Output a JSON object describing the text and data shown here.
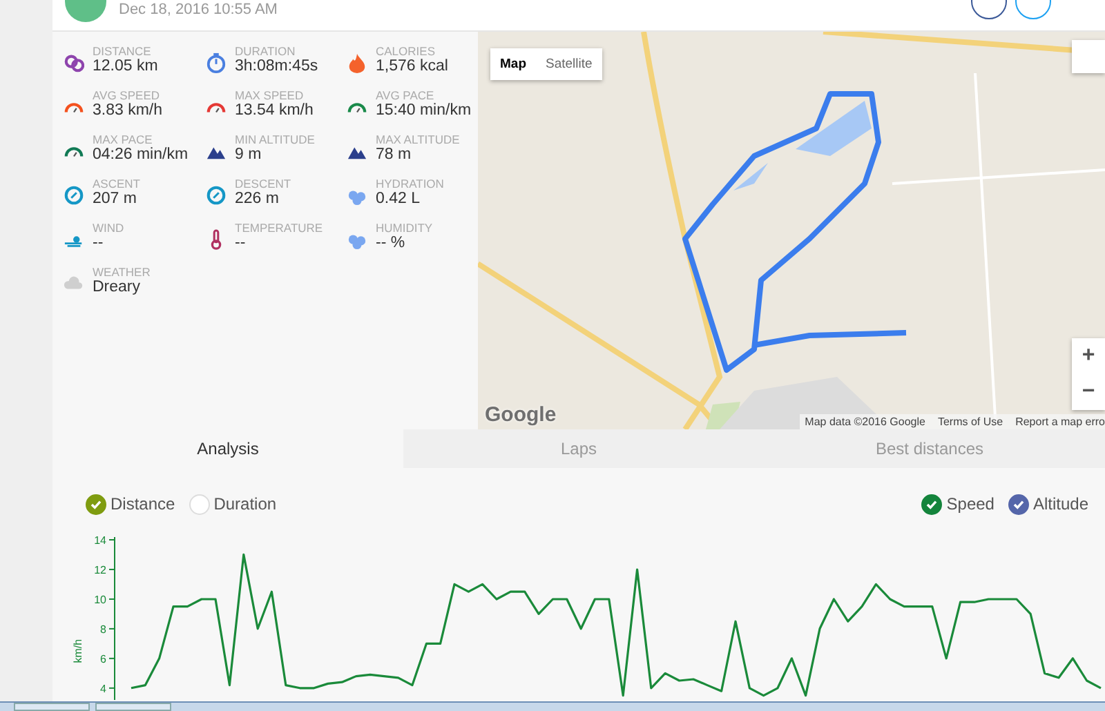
{
  "header": {
    "date": "Dec 18, 2016 10:55 AM"
  },
  "stats": [
    {
      "label": "DISTANCE",
      "value": "12.05 km"
    },
    {
      "label": "DURATION",
      "value": "3h:08m:45s"
    },
    {
      "label": "CALORIES",
      "value": "1,576 kcal"
    },
    {
      "label": "AVG SPEED",
      "value": "3.83 km/h"
    },
    {
      "label": "MAX SPEED",
      "value": "13.54 km/h"
    },
    {
      "label": "AVG PACE",
      "value": "15:40 min/km"
    },
    {
      "label": "MAX PACE",
      "value": "04:26 min/km"
    },
    {
      "label": "MIN ALTITUDE",
      "value": "9 m"
    },
    {
      "label": "MAX ALTITUDE",
      "value": "78 m"
    },
    {
      "label": "ASCENT",
      "value": "207 m"
    },
    {
      "label": "DESCENT",
      "value": "226 m"
    },
    {
      "label": "HYDRATION",
      "value": "0.42 L"
    },
    {
      "label": "WIND",
      "value": "--"
    },
    {
      "label": "TEMPERATURE",
      "value": "--"
    },
    {
      "label": "HUMIDITY",
      "value": "-- %"
    },
    {
      "label": "WEATHER",
      "value": "Dreary"
    }
  ],
  "map": {
    "kind": "picture",
    "types": [
      {
        "label": "Map",
        "selected": true
      },
      {
        "label": "Satellite",
        "selected": false
      }
    ],
    "zoom_in": "+",
    "zoom_out": "−",
    "logo": "Google",
    "attribution": [
      "Map data ©2016 Google",
      "Terms of Use",
      "Report a map erro"
    ]
  },
  "tabs": [
    {
      "label": "Analysis",
      "selected": true
    },
    {
      "label": "Laps",
      "selected": false
    },
    {
      "label": "Best distances",
      "selected": false
    }
  ],
  "x_axis_options": [
    {
      "label": "Distance",
      "checked": true,
      "color": "#7f9c10"
    },
    {
      "label": "Duration",
      "checked": false
    }
  ],
  "series_options": [
    {
      "checked": true,
      "color": "#14843c"
    },
    {
      "label": "Altitude",
      "checked": true,
      "color": "#5566aa"
    }
  ],
  "chart_data": {
    "type": "line",
    "ylabel": "km/h",
    "ylim": [
      3.2,
      14
    ],
    "yticks": [
      4,
      6,
      8,
      10,
      12,
      14
    ],
    "series": [
      {
        "name": "Speed",
        "color": "#1a8a3a",
        "values": [
          4,
          4.2,
          6,
          9.5,
          9.5,
          10,
          10,
          4.2,
          13,
          8,
          10.5,
          4.2,
          4,
          4,
          4.3,
          4.4,
          4.8,
          4.9,
          4.8,
          4.7,
          4.2,
          7,
          7,
          11,
          10.5,
          11,
          10,
          10.5,
          10.5,
          9,
          10,
          10,
          8,
          10,
          10,
          3.5,
          12,
          4,
          5,
          4.5,
          4.6,
          4.2,
          3.8,
          8.5,
          4,
          3.5,
          4,
          6,
          3.5,
          8,
          10,
          8.5,
          9.5,
          11,
          10,
          9.5,
          9.5,
          9.5,
          6,
          9.8,
          9.8,
          10,
          10,
          10,
          9,
          5,
          4.7,
          6,
          4.5,
          4
        ]
      }
    ]
  }
}
